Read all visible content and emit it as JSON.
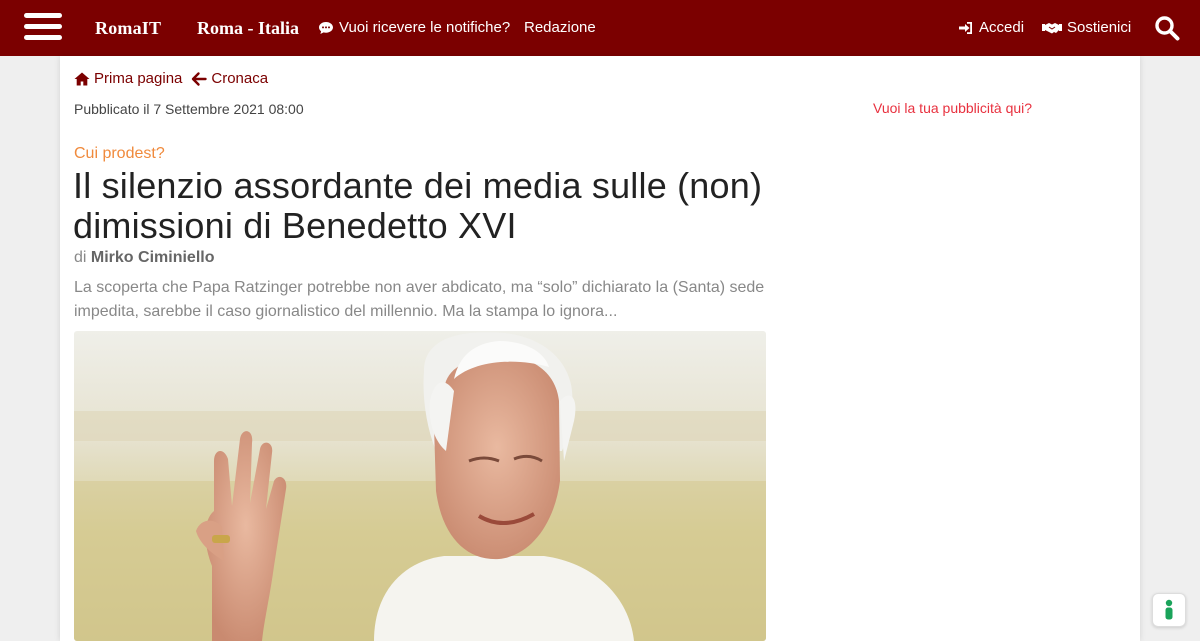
{
  "header": {
    "brand": "RomaIT",
    "city": "Roma - Italia",
    "notify_label": "Vuoi ricevere le notifiche?",
    "redazione_label": "Redazione",
    "login_label": "Accedi",
    "support_label": "Sostienici",
    "color": "#7b0000"
  },
  "breadcrumb": {
    "home_label": "Prima pagina",
    "section_label": "Cronaca"
  },
  "article": {
    "published": "Pubblicato il 7 Settembre 2021 08:00",
    "kicker": "Cui prodest?",
    "title": "Il silenzio assordante dei media sulle (non) dimissioni di Benedetto XVI",
    "byline_prefix": "di",
    "author": "Mirko Ciminiello",
    "summary": "La scoperta che Papa Ratzinger potrebbe non aver abdicato, ma “solo” dichiarato la (Santa) sede impedita, sarebbe il caso giornalistico del millennio. Ma la stampa lo ignora..."
  },
  "sidebar": {
    "ad_label": "Vuoi la tua pubblicità qui?"
  },
  "icons": {
    "menu": "hamburger-menu-icon",
    "chat": "chat-bubble-icon",
    "login": "sign-in-icon",
    "support": "handshake-icon",
    "search": "search-icon",
    "home": "home-icon",
    "back": "arrow-left-icon",
    "accessibility": "accessibility-icon"
  }
}
